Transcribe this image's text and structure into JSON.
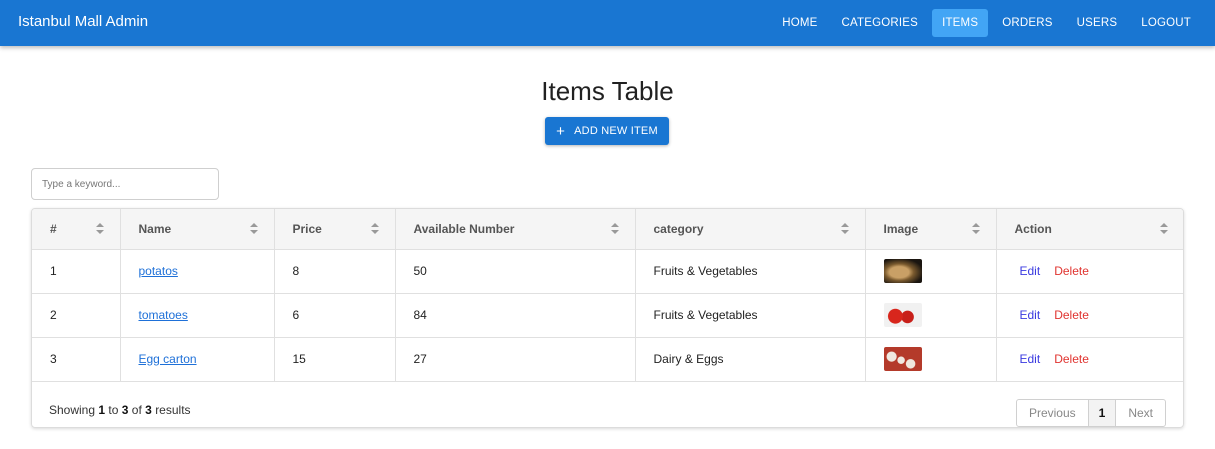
{
  "appbar": {
    "title": "Istanbul Mall Admin",
    "nav": [
      "HOME",
      "CATEGORIES",
      "ITEMS",
      "ORDERS",
      "USERS",
      "LOGOUT"
    ],
    "active": "ITEMS",
    "color": "#1976d2",
    "active_color": "#42a5f5"
  },
  "page": {
    "title": "Items Table",
    "add_button": "ADD NEW ITEM",
    "search_placeholder": "Type a keyword..."
  },
  "table": {
    "columns": [
      "#",
      "Name",
      "Price",
      "Available Number",
      "category",
      "Image",
      "Action"
    ],
    "rows": [
      {
        "id": "1",
        "name": "potatos",
        "price": "8",
        "available": "50",
        "category": "Fruits & Vegetables",
        "image": "potato-image"
      },
      {
        "id": "2",
        "name": "tomatoes",
        "price": "6",
        "available": "84",
        "category": "Fruits & Vegetables",
        "image": "tomato-image"
      },
      {
        "id": "3",
        "name": "Egg carton",
        "price": "15",
        "available": "27",
        "category": "Dairy & Eggs",
        "image": "eggs-image"
      }
    ],
    "edit_label": "Edit",
    "delete_label": "Delete"
  },
  "footer": {
    "showing_prefix": "Showing",
    "from": "1",
    "to_word": "to",
    "to": "3",
    "of_word": "of",
    "total": "3",
    "results_word": "results",
    "prev_label": "Previous",
    "current_page": "1",
    "next_label": "Next"
  }
}
